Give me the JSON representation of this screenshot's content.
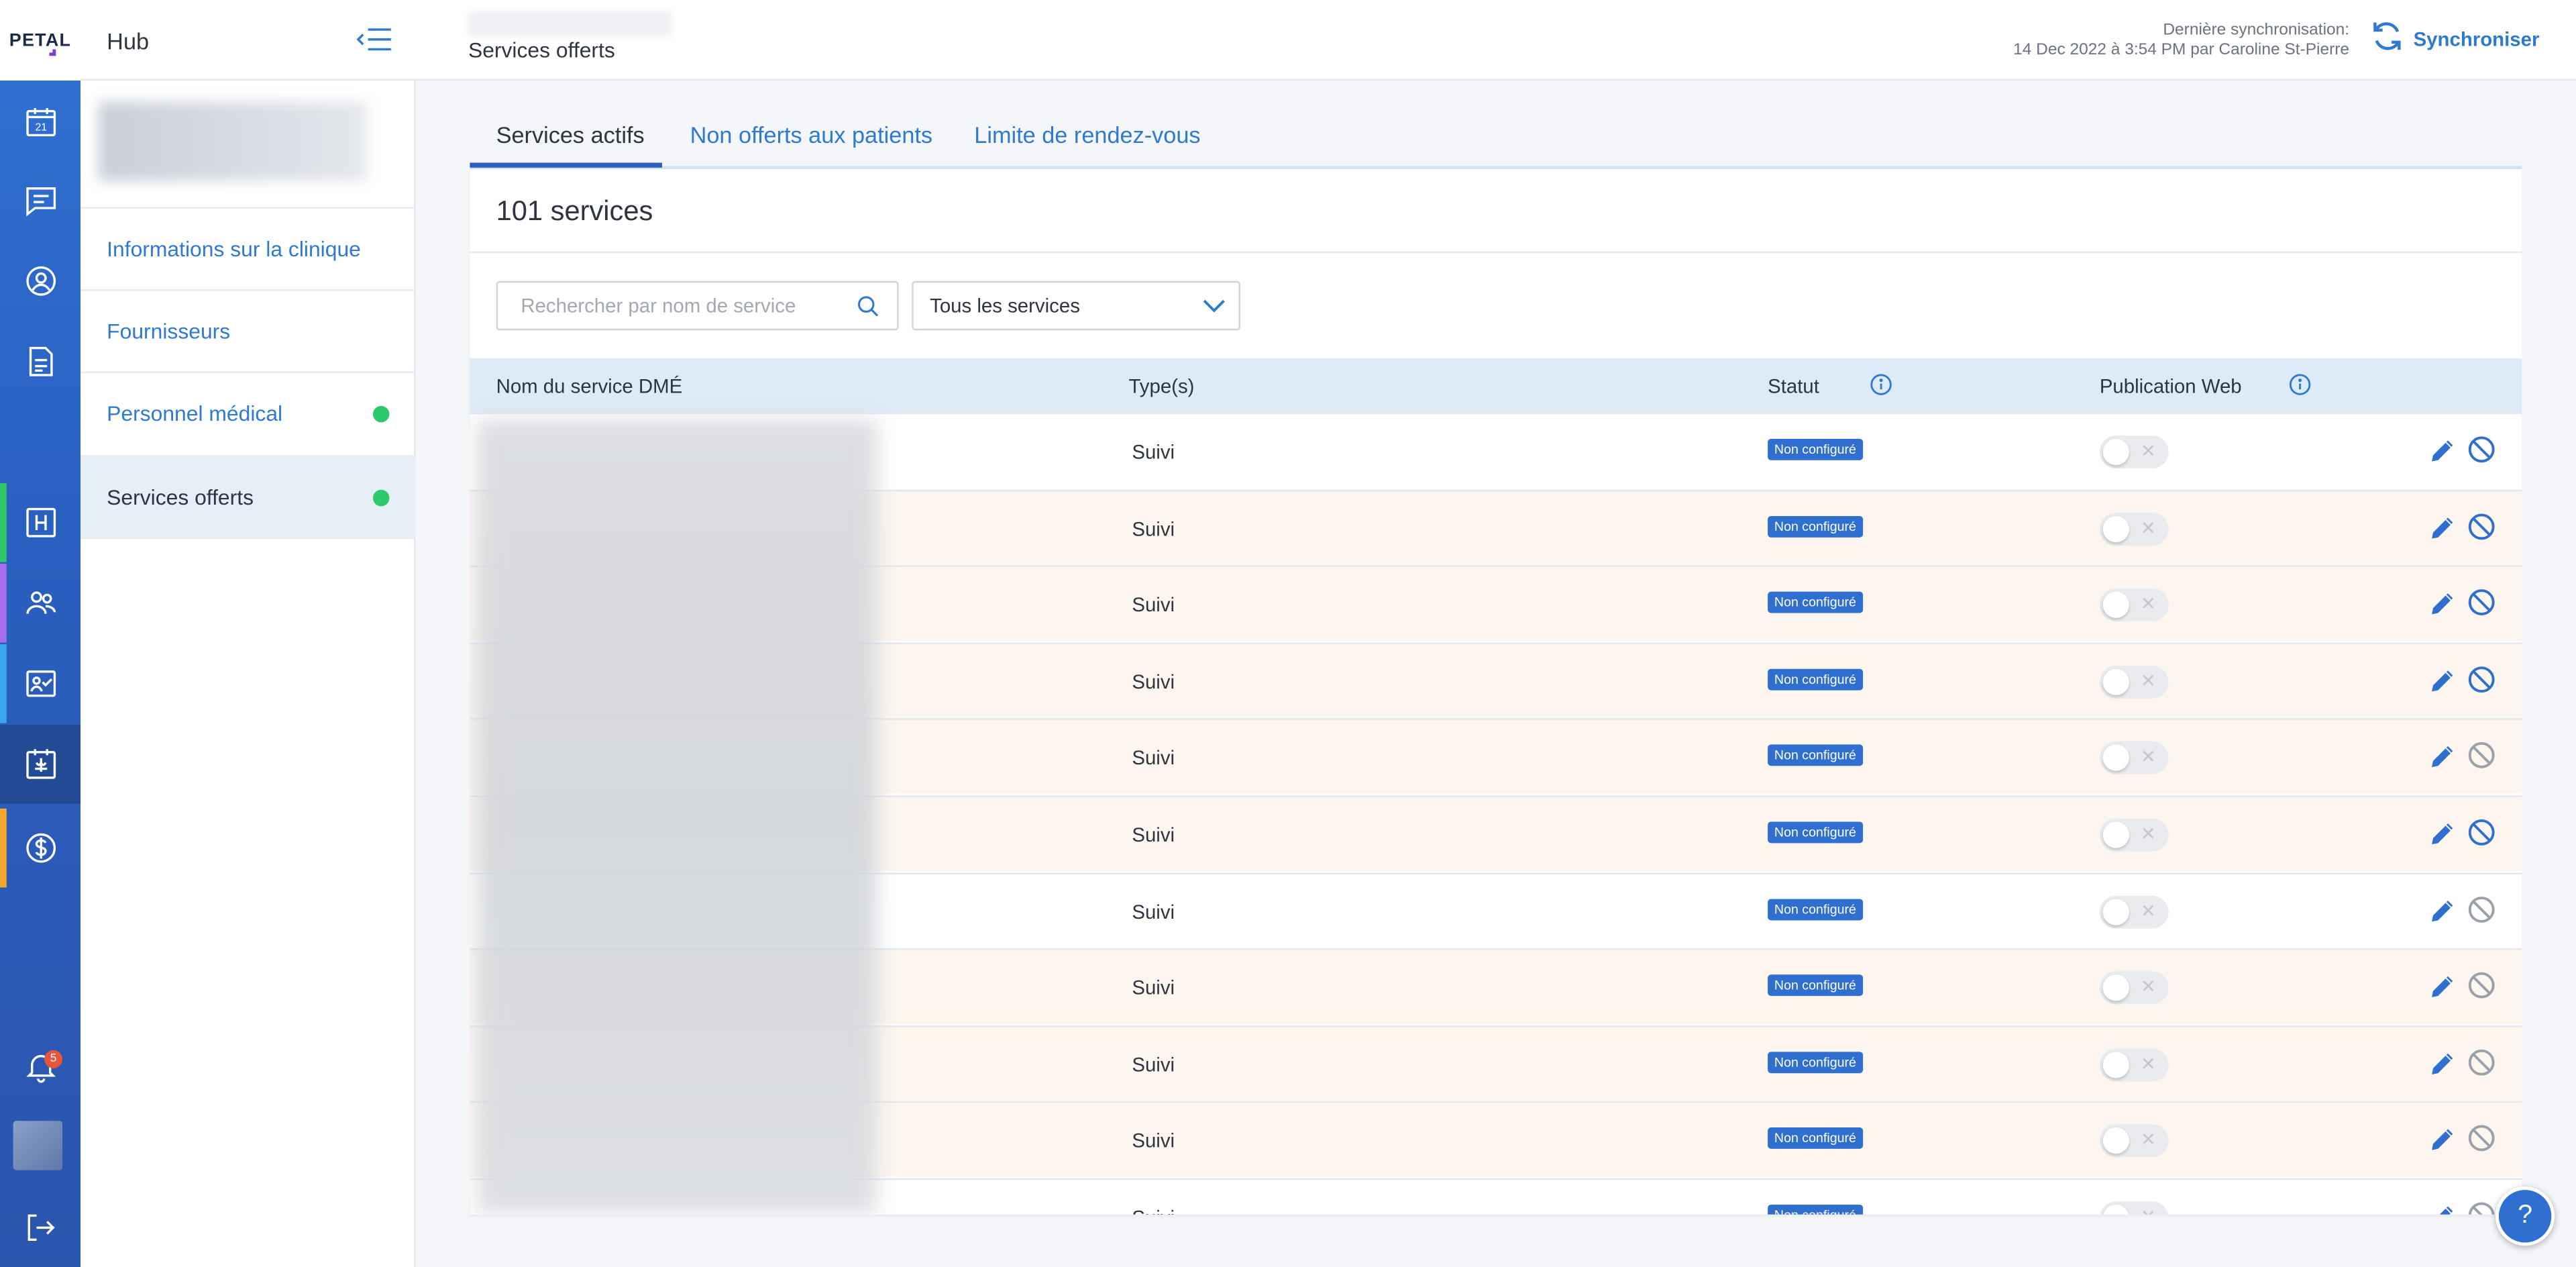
{
  "app": {
    "logo_text": "PETAL",
    "hub_title": "Hub"
  },
  "header": {
    "page_title": "Services offerts",
    "sync_label": "Dernière synchronisation:",
    "sync_detail": "14 Dec 2022 à 3:54 PM par Caroline St-Pierre",
    "sync_button": "Synchroniser"
  },
  "rail": {
    "items": [
      {
        "icon": "calendar-icon",
        "text": "21"
      },
      {
        "icon": "chat-icon"
      },
      {
        "icon": "user-circle-icon"
      },
      {
        "icon": "document-icon"
      },
      {
        "icon": "hospital-icon"
      },
      {
        "icon": "team-icon"
      },
      {
        "icon": "checklist-icon"
      },
      {
        "icon": "medical-icon"
      },
      {
        "icon": "dollar-icon"
      },
      {
        "icon": "bell-icon"
      },
      {
        "icon": "logout-icon"
      }
    ],
    "notifications_count": "5"
  },
  "subnav": {
    "items": [
      {
        "label": "Informations sur la clinique",
        "dot": false,
        "active": false
      },
      {
        "label": "Fournisseurs",
        "dot": false,
        "active": false
      },
      {
        "label": "Personnel médical",
        "dot": true,
        "active": false
      },
      {
        "label": "Services offerts",
        "dot": true,
        "active": true
      }
    ]
  },
  "tabs": [
    {
      "label": "Services actifs",
      "active": true
    },
    {
      "label": "Non offerts aux patients",
      "active": false
    },
    {
      "label": "Limite de rendez-vous",
      "active": false
    }
  ],
  "main": {
    "count_label": "101 services",
    "search_placeholder": "Rechercher par nom de service",
    "filter_value": "Tous les services",
    "columns": [
      "Nom du service DMÉ",
      "Type(s)",
      "Statut",
      "Publication Web"
    ],
    "rows": [
      {
        "type": "Suivi",
        "status": "Non configuré",
        "web": false,
        "disable_active": true
      },
      {
        "type": "Suivi",
        "status": "Non configuré",
        "web": false,
        "disable_active": true
      },
      {
        "type": "Suivi",
        "status": "Non configuré",
        "web": false,
        "disable_active": true
      },
      {
        "type": "Suivi",
        "status": "Non configuré",
        "web": false,
        "disable_active": true
      },
      {
        "type": "Suivi",
        "status": "Non configuré",
        "web": false,
        "disable_active": false
      },
      {
        "type": "Suivi",
        "status": "Non configuré",
        "web": false,
        "disable_active": true
      },
      {
        "type": "Suivi",
        "status": "Non configuré",
        "web": false,
        "disable_active": false
      },
      {
        "type": "Suivi",
        "status": "Non configuré",
        "web": false,
        "disable_active": false
      },
      {
        "type": "Suivi",
        "status": "Non configuré",
        "web": false,
        "disable_active": false
      },
      {
        "type": "Suivi",
        "status": "Non configuré",
        "web": false,
        "disable_active": false
      },
      {
        "type": "Suivi",
        "status": "Non configuré",
        "web": false,
        "disable_active": false
      }
    ]
  },
  "help_label": "?",
  "colors": {
    "accent": "#2f7ad1",
    "rail": "#2a5fbf",
    "status_badge": "#2f6fd0",
    "dot": "#2ec96b",
    "row_alt": "#fdf6ef"
  }
}
